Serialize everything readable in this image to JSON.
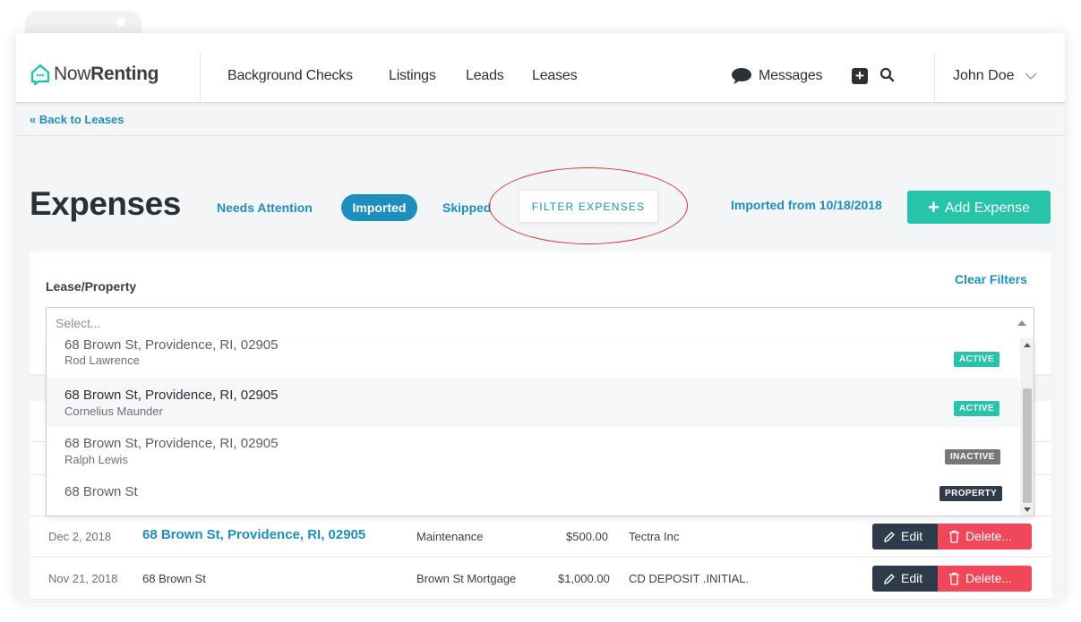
{
  "app": {
    "logo_prefix": "Now",
    "logo_suffix": "Renting"
  },
  "nav": {
    "links": [
      "Background Checks",
      "Listings",
      "Leads",
      "Leases"
    ],
    "messages": "Messages",
    "user": "John Doe"
  },
  "breadcrumb": "« Back to Leases",
  "page": {
    "title": "Expenses",
    "tabs": {
      "needs_attention": "Needs Attention",
      "imported": "Imported",
      "skipped": "Skipped"
    },
    "filter_button": "FILTER EXPENSES",
    "imported_from": "Imported from 10/18/2018",
    "add_button": "Add Expense"
  },
  "filter": {
    "label": "Lease/Property",
    "clear": "Clear Filters",
    "placeholder": "Select...",
    "options": [
      {
        "address": "68 Brown St, Providence, RI, 02905",
        "name": "Rod Lawrence",
        "badge": "ACTIVE"
      },
      {
        "address": "68 Brown St, Providence, RI, 02905",
        "name": "Cornelius Maunder",
        "badge": "ACTIVE"
      },
      {
        "address": "68 Brown St, Providence, RI, 02905",
        "name": "Ralph Lewis",
        "badge": "INACTIVE"
      },
      {
        "address": "68 Brown St",
        "name": "",
        "badge": "PROPERTY"
      }
    ]
  },
  "table": {
    "rows": [
      {
        "date": "Dec 2, 2018",
        "property": "68 Brown St, Providence, RI, 02905",
        "category": "Maintenance",
        "amount": "$500.00",
        "payee": "Tectra Inc",
        "edit": "Edit",
        "delete": "Delete..."
      },
      {
        "date": "Nov 21, 2018",
        "property": "68 Brown St",
        "category": "Brown St Mortgage",
        "amount": "$1,000.00",
        "payee": "CD DEPOSIT .INITIAL.",
        "edit": "Edit",
        "delete": "Delete..."
      }
    ]
  },
  "colors": {
    "accent": "#1d8fbf",
    "add_button": "#27c4a9",
    "delete": "#f0485a",
    "edit": "#2d3b4a",
    "badge_active": "#27c4a9",
    "badge_inactive": "#777777",
    "badge_property": "#2d3b4a",
    "annotation": "#e03131"
  }
}
